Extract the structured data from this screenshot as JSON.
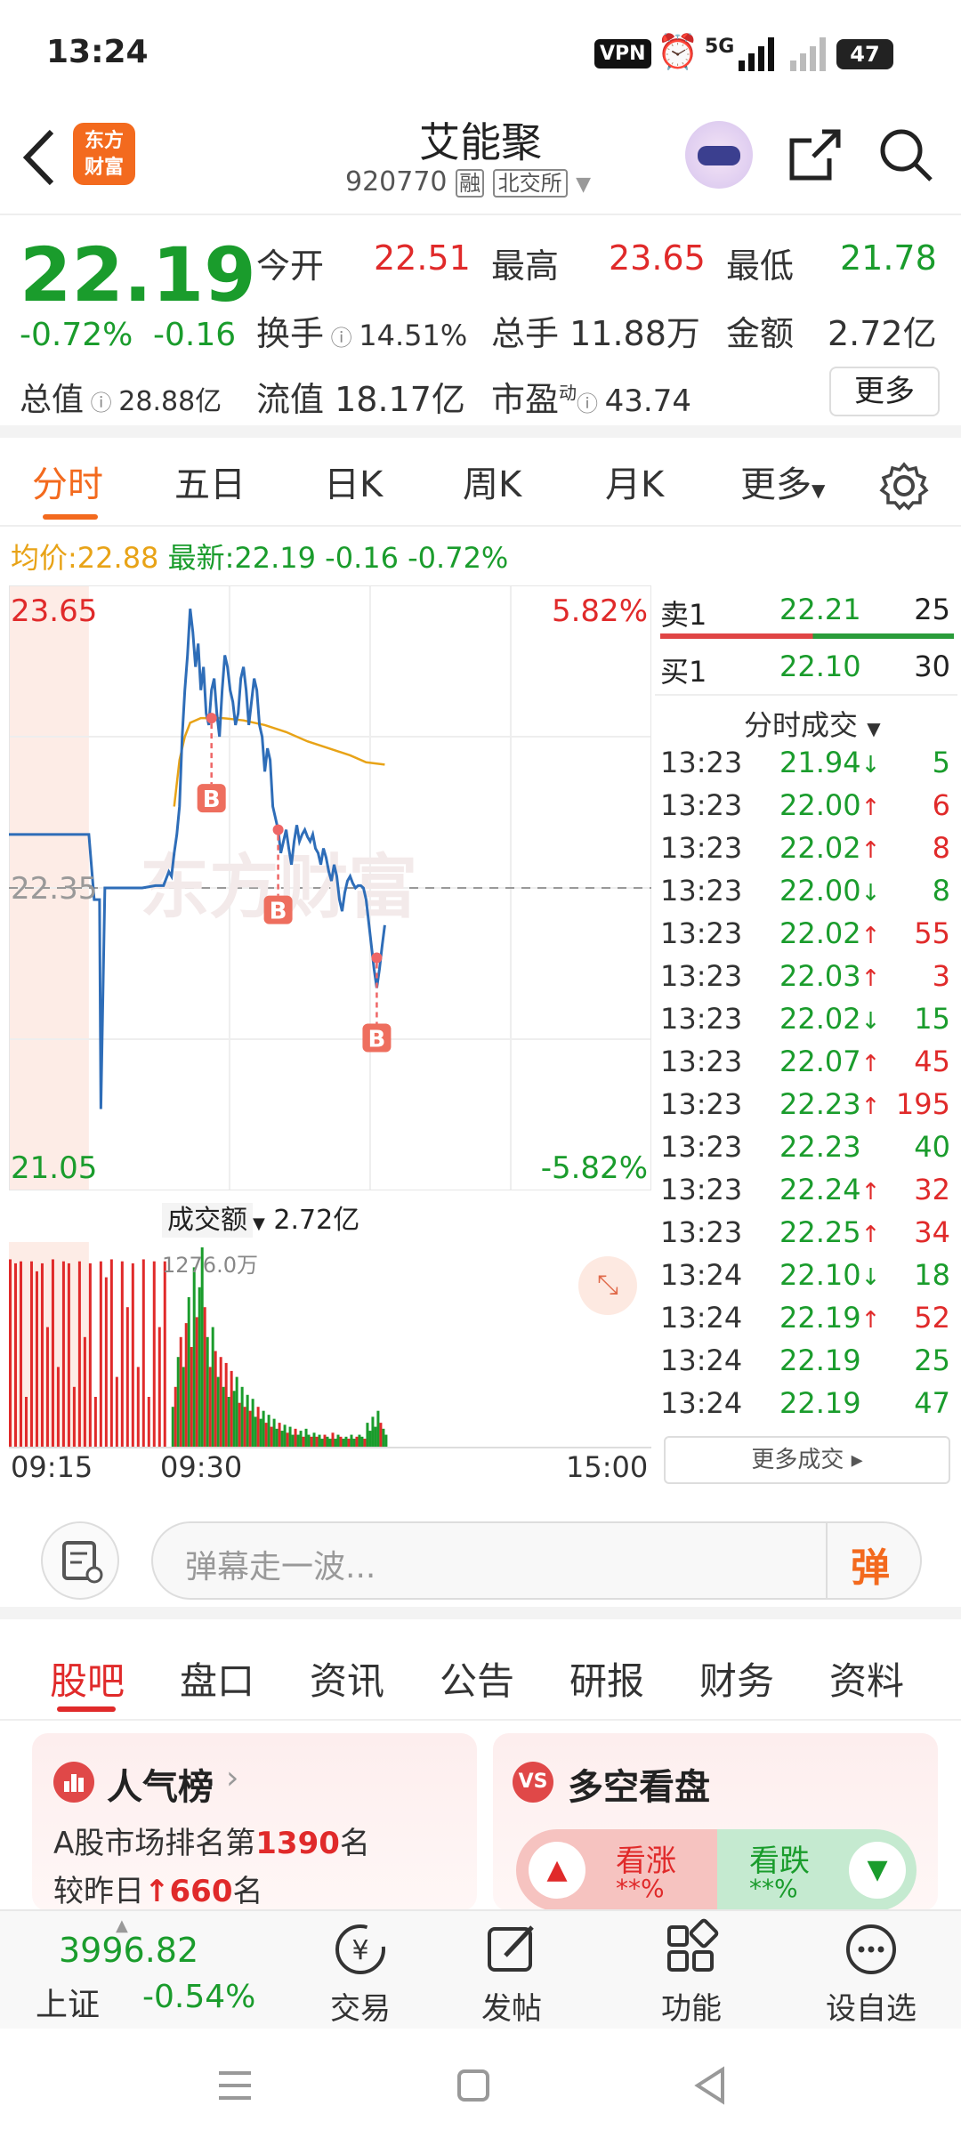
{
  "status_bar": {
    "time": "13:24",
    "vpn": "VPN",
    "signal": "5G",
    "battery": "47"
  },
  "header": {
    "logo_line1": "东方",
    "logo_line2": "财富",
    "stock_name": "艾能聚",
    "stock_code": "920770",
    "tag_rong": "融",
    "tag_exchange": "北交所"
  },
  "quote": {
    "price": "22.19",
    "change_pct": "-0.72%",
    "change": "-0.16",
    "open_label": "今开",
    "open": "22.51",
    "high_label": "最高",
    "high": "23.65",
    "low_label": "最低",
    "low": "21.78",
    "turnover_label": "换手",
    "turnover": "14.51%",
    "volume_label": "总手",
    "volume": "11.88万",
    "amount_label": "金额",
    "amount": "2.72亿",
    "mktcap_label": "总值",
    "mktcap": "28.88亿",
    "float_label": "流值",
    "float": "18.17亿",
    "pe_label": "市盈",
    "pe_sup": "动",
    "pe": "43.74",
    "more_button": "更多"
  },
  "tabs": [
    "分时",
    "五日",
    "日K",
    "周K",
    "月K",
    "更多"
  ],
  "avg_bar": {
    "avg_label": "均价:",
    "avg": "22.88",
    "latest_label": "最新:",
    "latest": "22.19",
    "latest_change": "-0.16",
    "latest_pct": "-0.72%"
  },
  "chart_data": {
    "type": "line",
    "y_max_label": "23.65",
    "y_min_label": "21.05",
    "y_mid_label": "22.35",
    "pct_max_label": "5.82%",
    "pct_min_label": "-5.82%",
    "ylim": [
      21.05,
      23.65
    ],
    "prev_close": 22.35,
    "watermark": "东方财富",
    "x_ticks": [
      "09:15",
      "09:30",
      "15:00"
    ],
    "price_series": [
      [
        0,
        22.58
      ],
      [
        10,
        22.58
      ],
      [
        20,
        22.58
      ],
      [
        28,
        22.58
      ],
      [
        30,
        22.58
      ],
      [
        32,
        22.3
      ],
      [
        34,
        22.3
      ],
      [
        34.5,
        21.4
      ],
      [
        36,
        22.35
      ],
      [
        40,
        22.35
      ],
      [
        50,
        22.35
      ],
      [
        55,
        22.36
      ],
      [
        58,
        22.36
      ],
      [
        60,
        22.42
      ],
      [
        61,
        22.4
      ],
      [
        62,
        22.5
      ],
      [
        63,
        22.58
      ],
      [
        64,
        22.7
      ],
      [
        65,
        23.0
      ],
      [
        66,
        23.2
      ],
      [
        67,
        23.35
      ],
      [
        68,
        23.55
      ],
      [
        69,
        23.45
      ],
      [
        70,
        23.3
      ],
      [
        71,
        23.4
      ],
      [
        72,
        23.2
      ],
      [
        73,
        23.3
      ],
      [
        74,
        23.1
      ],
      [
        75,
        23.05
      ],
      [
        76,
        23.2
      ],
      [
        77,
        23.25
      ],
      [
        78,
        23.1
      ],
      [
        79,
        23.0
      ],
      [
        80,
        23.2
      ],
      [
        81,
        23.35
      ],
      [
        82,
        23.3
      ],
      [
        83,
        23.2
      ],
      [
        84,
        23.15
      ],
      [
        85,
        23.05
      ],
      [
        86,
        23.1
      ],
      [
        87,
        23.25
      ],
      [
        88,
        23.3
      ],
      [
        89,
        23.2
      ],
      [
        90,
        23.05
      ],
      [
        91,
        23.15
      ],
      [
        92,
        23.25
      ],
      [
        93,
        23.2
      ],
      [
        94,
        23.05
      ],
      [
        95,
        23.0
      ],
      [
        96,
        22.85
      ],
      [
        97,
        22.95
      ],
      [
        98,
        22.9
      ],
      [
        99,
        22.7
      ],
      [
        100,
        22.65
      ],
      [
        101,
        22.6
      ],
      [
        102,
        22.5
      ],
      [
        103,
        22.55
      ],
      [
        104,
        22.6
      ],
      [
        105,
        22.52
      ],
      [
        106,
        22.45
      ],
      [
        107,
        22.55
      ],
      [
        108,
        22.62
      ],
      [
        109,
        22.55
      ],
      [
        110,
        22.58
      ],
      [
        111,
        22.6
      ],
      [
        112,
        22.57
      ],
      [
        113,
        22.55
      ],
      [
        114,
        22.58
      ],
      [
        115,
        22.52
      ],
      [
        116,
        22.5
      ],
      [
        117,
        22.45
      ],
      [
        118,
        22.52
      ],
      [
        119,
        22.48
      ],
      [
        120,
        22.42
      ],
      [
        121,
        22.38
      ],
      [
        122,
        22.45
      ],
      [
        123,
        22.4
      ],
      [
        124,
        22.3
      ],
      [
        125,
        22.25
      ],
      [
        126,
        22.33
      ],
      [
        127,
        22.38
      ],
      [
        128,
        22.4
      ],
      [
        129,
        22.37
      ],
      [
        130,
        22.35
      ],
      [
        131,
        22.36
      ],
      [
        132,
        22.36
      ],
      [
        133,
        22.35
      ],
      [
        134,
        22.3
      ],
      [
        135,
        22.2
      ],
      [
        136,
        22.1
      ],
      [
        137,
        22.0
      ],
      [
        138,
        21.92
      ],
      [
        139,
        22.0
      ],
      [
        140,
        22.1
      ],
      [
        141,
        22.19
      ]
    ],
    "avg_series": [
      [
        62,
        22.7
      ],
      [
        64,
        22.9
      ],
      [
        66,
        23.0
      ],
      [
        68,
        23.06
      ],
      [
        72,
        23.08
      ],
      [
        80,
        23.08
      ],
      [
        88,
        23.07
      ],
      [
        96,
        23.05
      ],
      [
        104,
        23.02
      ],
      [
        112,
        22.98
      ],
      [
        120,
        22.95
      ],
      [
        128,
        22.92
      ],
      [
        134,
        22.89
      ],
      [
        141,
        22.88
      ]
    ],
    "b_markers": [
      {
        "x": 76,
        "price": 23.08,
        "label": "B"
      },
      {
        "x": 101,
        "price": 22.6,
        "label": "B"
      },
      {
        "x": 138,
        "price": 22.05,
        "label": "B"
      }
    ],
    "volume_label": "成交额",
    "volume_total": "2.72亿",
    "volume_max_label": "1276.0万",
    "volume_bars": [
      {
        "x": 0,
        "v": 0.94,
        "c": "r"
      },
      {
        "x": 2,
        "v": 0.92,
        "c": "r"
      },
      {
        "x": 4,
        "v": 0.93,
        "c": "r"
      },
      {
        "x": 6,
        "v": 0.25,
        "c": "r"
      },
      {
        "x": 8,
        "v": 0.93,
        "c": "r"
      },
      {
        "x": 10,
        "v": 0.88,
        "c": "r"
      },
      {
        "x": 12,
        "v": 0.92,
        "c": "r"
      },
      {
        "x": 14,
        "v": 0.6,
        "c": "r"
      },
      {
        "x": 16,
        "v": 0.94,
        "c": "r"
      },
      {
        "x": 18,
        "v": 0.4,
        "c": "r"
      },
      {
        "x": 20,
        "v": 0.93,
        "c": "r"
      },
      {
        "x": 22,
        "v": 0.92,
        "c": "r"
      },
      {
        "x": 24,
        "v": 0.3,
        "c": "r"
      },
      {
        "x": 26,
        "v": 0.93,
        "c": "r"
      },
      {
        "x": 28,
        "v": 0.55,
        "c": "r"
      },
      {
        "x": 30,
        "v": 0.92,
        "c": "r"
      },
      {
        "x": 32,
        "v": 0.25,
        "c": "r"
      },
      {
        "x": 34,
        "v": 0.93,
        "c": "r"
      },
      {
        "x": 36,
        "v": 0.85,
        "c": "r"
      },
      {
        "x": 38,
        "v": 0.94,
        "c": "r"
      },
      {
        "x": 40,
        "v": 0.35,
        "c": "r"
      },
      {
        "x": 42,
        "v": 0.93,
        "c": "r"
      },
      {
        "x": 44,
        "v": 0.7,
        "c": "r"
      },
      {
        "x": 46,
        "v": 0.92,
        "c": "r"
      },
      {
        "x": 48,
        "v": 0.4,
        "c": "r"
      },
      {
        "x": 50,
        "v": 0.94,
        "c": "r"
      },
      {
        "x": 52,
        "v": 0.25,
        "c": "r"
      },
      {
        "x": 54,
        "v": 0.93,
        "c": "r"
      },
      {
        "x": 56,
        "v": 0.6,
        "c": "r"
      },
      {
        "x": 58,
        "v": 0.93,
        "c": "r"
      },
      {
        "x": 61,
        "v": 0.2,
        "c": "g"
      },
      {
        "x": 62,
        "v": 0.3,
        "c": "r"
      },
      {
        "x": 63,
        "v": 0.45,
        "c": "g"
      },
      {
        "x": 64,
        "v": 0.55,
        "c": "r"
      },
      {
        "x": 65,
        "v": 0.4,
        "c": "g"
      },
      {
        "x": 66,
        "v": 0.62,
        "c": "r"
      },
      {
        "x": 67,
        "v": 0.75,
        "c": "g"
      },
      {
        "x": 68,
        "v": 0.5,
        "c": "r"
      },
      {
        "x": 69,
        "v": 0.9,
        "c": "g"
      },
      {
        "x": 70,
        "v": 0.65,
        "c": "r"
      },
      {
        "x": 71,
        "v": 0.8,
        "c": "g"
      },
      {
        "x": 72,
        "v": 1.0,
        "c": "g"
      },
      {
        "x": 73,
        "v": 0.7,
        "c": "r"
      },
      {
        "x": 74,
        "v": 0.55,
        "c": "g"
      },
      {
        "x": 75,
        "v": 0.4,
        "c": "r"
      },
      {
        "x": 76,
        "v": 0.6,
        "c": "g"
      },
      {
        "x": 77,
        "v": 0.48,
        "c": "r"
      },
      {
        "x": 78,
        "v": 0.35,
        "c": "g"
      },
      {
        "x": 79,
        "v": 0.45,
        "c": "r"
      },
      {
        "x": 80,
        "v": 0.3,
        "c": "g"
      },
      {
        "x": 81,
        "v": 0.42,
        "c": "r"
      },
      {
        "x": 82,
        "v": 0.25,
        "c": "g"
      },
      {
        "x": 83,
        "v": 0.38,
        "c": "r"
      },
      {
        "x": 84,
        "v": 0.28,
        "c": "g"
      },
      {
        "x": 85,
        "v": 0.35,
        "c": "g"
      },
      {
        "x": 86,
        "v": 0.22,
        "c": "r"
      },
      {
        "x": 87,
        "v": 0.3,
        "c": "g"
      },
      {
        "x": 88,
        "v": 0.2,
        "c": "r"
      },
      {
        "x": 89,
        "v": 0.26,
        "c": "g"
      },
      {
        "x": 90,
        "v": 0.18,
        "c": "r"
      },
      {
        "x": 91,
        "v": 0.24,
        "c": "g"
      },
      {
        "x": 92,
        "v": 0.15,
        "c": "g"
      },
      {
        "x": 93,
        "v": 0.2,
        "c": "r"
      },
      {
        "x": 94,
        "v": 0.14,
        "c": "g"
      },
      {
        "x": 95,
        "v": 0.18,
        "c": "g"
      },
      {
        "x": 96,
        "v": 0.12,
        "c": "r"
      },
      {
        "x": 97,
        "v": 0.16,
        "c": "g"
      },
      {
        "x": 98,
        "v": 0.1,
        "c": "r"
      },
      {
        "x": 99,
        "v": 0.14,
        "c": "g"
      },
      {
        "x": 100,
        "v": 0.09,
        "c": "g"
      },
      {
        "x": 101,
        "v": 0.12,
        "c": "r"
      },
      {
        "x": 102,
        "v": 0.08,
        "c": "g"
      },
      {
        "x": 103,
        "v": 0.11,
        "c": "g"
      },
      {
        "x": 104,
        "v": 0.07,
        "c": "r"
      },
      {
        "x": 105,
        "v": 0.1,
        "c": "g"
      },
      {
        "x": 106,
        "v": 0.06,
        "c": "g"
      },
      {
        "x": 107,
        "v": 0.09,
        "c": "r"
      },
      {
        "x": 108,
        "v": 0.06,
        "c": "g"
      },
      {
        "x": 109,
        "v": 0.08,
        "c": "g"
      },
      {
        "x": 110,
        "v": 0.05,
        "c": "r"
      },
      {
        "x": 111,
        "v": 0.09,
        "c": "g"
      },
      {
        "x": 112,
        "v": 0.06,
        "c": "g"
      },
      {
        "x": 113,
        "v": 0.05,
        "c": "r"
      },
      {
        "x": 114,
        "v": 0.07,
        "c": "g"
      },
      {
        "x": 115,
        "v": 0.05,
        "c": "r"
      },
      {
        "x": 116,
        "v": 0.06,
        "c": "g"
      },
      {
        "x": 117,
        "v": 0.04,
        "c": "g"
      },
      {
        "x": 118,
        "v": 0.06,
        "c": "r"
      },
      {
        "x": 119,
        "v": 0.05,
        "c": "g"
      },
      {
        "x": 120,
        "v": 0.04,
        "c": "g"
      },
      {
        "x": 121,
        "v": 0.07,
        "c": "r"
      },
      {
        "x": 122,
        "v": 0.04,
        "c": "g"
      },
      {
        "x": 123,
        "v": 0.06,
        "c": "g"
      },
      {
        "x": 124,
        "v": 0.05,
        "c": "r"
      },
      {
        "x": 125,
        "v": 0.04,
        "c": "g"
      },
      {
        "x": 126,
        "v": 0.05,
        "c": "g"
      },
      {
        "x": 127,
        "v": 0.04,
        "c": "r"
      },
      {
        "x": 128,
        "v": 0.06,
        "c": "g"
      },
      {
        "x": 129,
        "v": 0.04,
        "c": "g"
      },
      {
        "x": 130,
        "v": 0.05,
        "c": "r"
      },
      {
        "x": 131,
        "v": 0.06,
        "c": "g"
      },
      {
        "x": 132,
        "v": 0.05,
        "c": "g"
      },
      {
        "x": 133,
        "v": 0.04,
        "c": "r"
      },
      {
        "x": 134,
        "v": 0.12,
        "c": "g"
      },
      {
        "x": 135,
        "v": 0.08,
        "c": "g"
      },
      {
        "x": 136,
        "v": 0.15,
        "c": "g"
      },
      {
        "x": 137,
        "v": 0.1,
        "c": "g"
      },
      {
        "x": 138,
        "v": 0.18,
        "c": "g"
      },
      {
        "x": 139,
        "v": 0.12,
        "c": "r"
      },
      {
        "x": 140,
        "v": 0.09,
        "c": "g"
      },
      {
        "x": 141,
        "v": 0.06,
        "c": "g"
      }
    ]
  },
  "order_book": {
    "sell1_label": "卖1",
    "sell1_price": "22.21",
    "sell1_vol": "25",
    "buy1_label": "买1",
    "buy1_price": "22.10",
    "buy1_vol": "30"
  },
  "trades_header": "分时成交",
  "trades": [
    {
      "time": "13:23",
      "price": "21.94",
      "arrow": "↓",
      "vol": "5",
      "dir": "down"
    },
    {
      "time": "13:23",
      "price": "22.00",
      "arrow": "↑",
      "vol": "6",
      "dir": "up"
    },
    {
      "time": "13:23",
      "price": "22.02",
      "arrow": "↑",
      "vol": "8",
      "dir": "up"
    },
    {
      "time": "13:23",
      "price": "22.00",
      "arrow": "↓",
      "vol": "8",
      "dir": "down"
    },
    {
      "time": "13:23",
      "price": "22.02",
      "arrow": "↑",
      "vol": "55",
      "dir": "up"
    },
    {
      "time": "13:23",
      "price": "22.03",
      "arrow": "↑",
      "vol": "3",
      "dir": "up"
    },
    {
      "time": "13:23",
      "price": "22.02",
      "arrow": "↓",
      "vol": "15",
      "dir": "down"
    },
    {
      "time": "13:23",
      "price": "22.07",
      "arrow": "↑",
      "vol": "45",
      "dir": "up"
    },
    {
      "time": "13:23",
      "price": "22.23",
      "arrow": "↑",
      "vol": "195",
      "dir": "up"
    },
    {
      "time": "13:23",
      "price": "22.23",
      "arrow": "",
      "vol": "40",
      "dir": "flat"
    },
    {
      "time": "13:23",
      "price": "22.24",
      "arrow": "↑",
      "vol": "32",
      "dir": "up"
    },
    {
      "time": "13:23",
      "price": "22.25",
      "arrow": "↑",
      "vol": "34",
      "dir": "up"
    },
    {
      "time": "13:24",
      "price": "22.10",
      "arrow": "↓",
      "vol": "18",
      "dir": "down"
    },
    {
      "time": "13:24",
      "price": "22.19",
      "arrow": "↑",
      "vol": "52",
      "dir": "up"
    },
    {
      "time": "13:24",
      "price": "22.19",
      "arrow": "",
      "vol": "25",
      "dir": "flat"
    },
    {
      "time": "13:24",
      "price": "22.19",
      "arrow": "",
      "vol": "47",
      "dir": "flat"
    }
  ],
  "more_trades": "更多成交 ▸",
  "danmu_placeholder": "弹幕走一波...",
  "danmu_button": "弹",
  "forum_tabs": [
    "股吧",
    "盘口",
    "资讯",
    "公告",
    "研报",
    "财务",
    "资料"
  ],
  "popularity": {
    "title": "人气榜",
    "rank_prefix": "A股市场排名第",
    "rank": "1390",
    "rank_suffix": "名",
    "change_prefix": "较昨日",
    "change_arrow": "↑",
    "change": "660",
    "change_suffix": "名"
  },
  "bullbear": {
    "title": "多空看盘",
    "bull_label": "看涨",
    "bull_value": "**%",
    "bear_label": "看跌",
    "bear_value": "**%"
  },
  "bottom_nav": {
    "index_value": "3996.82",
    "index_name": "上证",
    "index_change": "-0.54%",
    "trade": "交易",
    "post": "发帖",
    "function": "功能",
    "watchlist": "设自选"
  },
  "colors": {
    "up": "#e02a2a",
    "down": "#1a9c2c",
    "accent": "#f36a1e",
    "avg": "#e8a317",
    "line": "#2e6db8"
  }
}
